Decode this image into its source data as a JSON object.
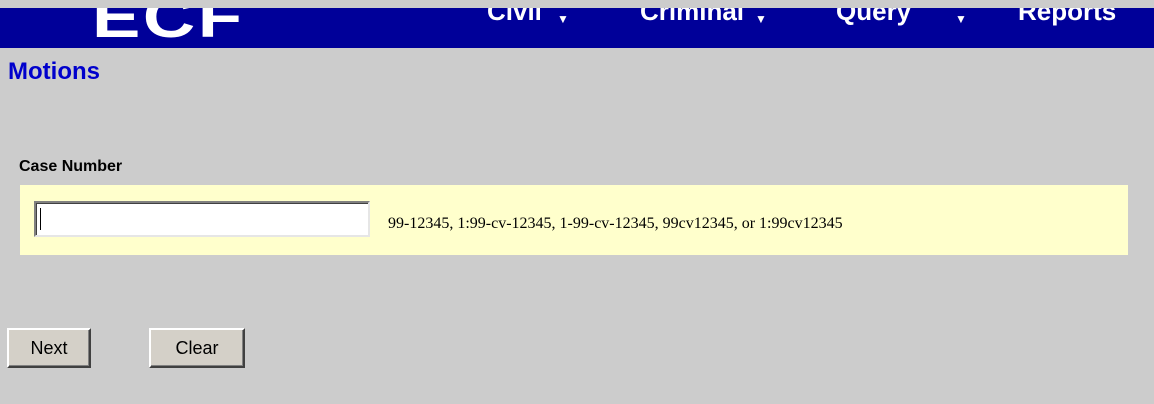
{
  "header": {
    "logo_text": "ECF",
    "menu": [
      {
        "label": "Civil"
      },
      {
        "label": "Criminal"
      },
      {
        "label": "Query"
      },
      {
        "label": "Reports"
      }
    ]
  },
  "page": {
    "title": "Motions"
  },
  "form": {
    "case_number_label": "Case Number",
    "case_number_value": "",
    "case_number_hint": "99-12345, 1:99-cv-12345, 1-99-cv-12345, 99cv12345, or 1:99cv12345"
  },
  "buttons": {
    "next_label": "Next",
    "clear_label": "Clear"
  },
  "colors": {
    "header_bg": "#000099",
    "page_bg": "#cccccc",
    "title": "#0000cc",
    "field_panel_bg": "#ffffcc"
  }
}
